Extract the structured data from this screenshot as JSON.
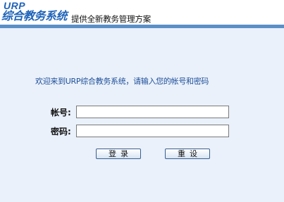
{
  "header": {
    "logo_urp": "URP",
    "logo_name": "综合教务系统",
    "tagline": "提供全新教务管理方案"
  },
  "login": {
    "welcome": "欢迎来到URP综合教务系统，请输入您的帐号和密码",
    "account_label": "帐号:",
    "account_value": "",
    "password_label": "密码:",
    "password_value": "",
    "login_button": "登录",
    "reset_button": "重设"
  },
  "colors": {
    "brand": "#1f63b8",
    "header_bar": "#5b8fc7",
    "background": "#eaf1fb"
  }
}
